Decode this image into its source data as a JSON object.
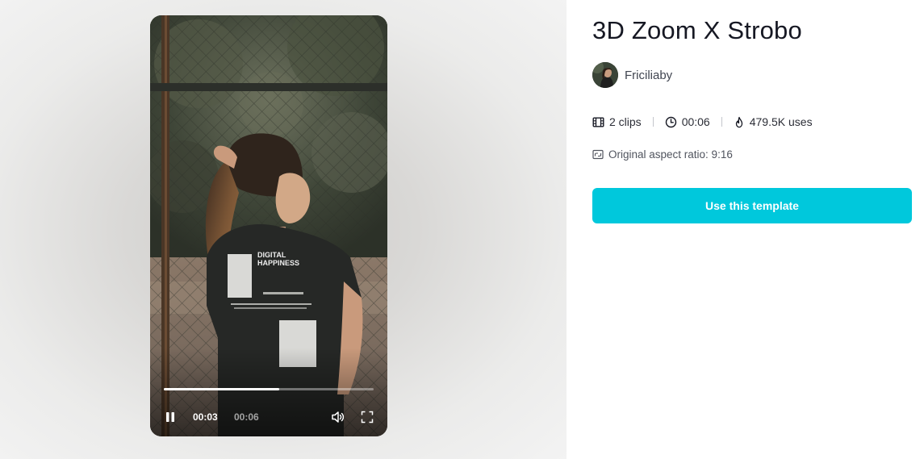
{
  "template": {
    "title": "3D Zoom X Strobo",
    "author": {
      "name": "Friciliaby"
    },
    "stats": {
      "clips": "2 clips",
      "duration": "00:06",
      "uses": "479.5K uses"
    },
    "aspect_ratio": "Original aspect ratio: 9:16",
    "cta_label": "Use this template"
  },
  "player": {
    "current_time": "00:03",
    "total_time": "00:06",
    "progress": 0.55,
    "state": "playing",
    "shirt_text": [
      "DIGITAL",
      "HAPPINESS"
    ]
  },
  "icons": {
    "pause": "pause-icon",
    "volume": "volume-icon",
    "fullscreen": "fullscreen-icon",
    "clips": "film-icon",
    "duration": "clock-icon",
    "uses": "flame-icon",
    "aspect": "aspect-ratio-icon"
  },
  "colors": {
    "accent": "#00c8dc",
    "text_primary": "#161823",
    "text_secondary": "#404550"
  }
}
